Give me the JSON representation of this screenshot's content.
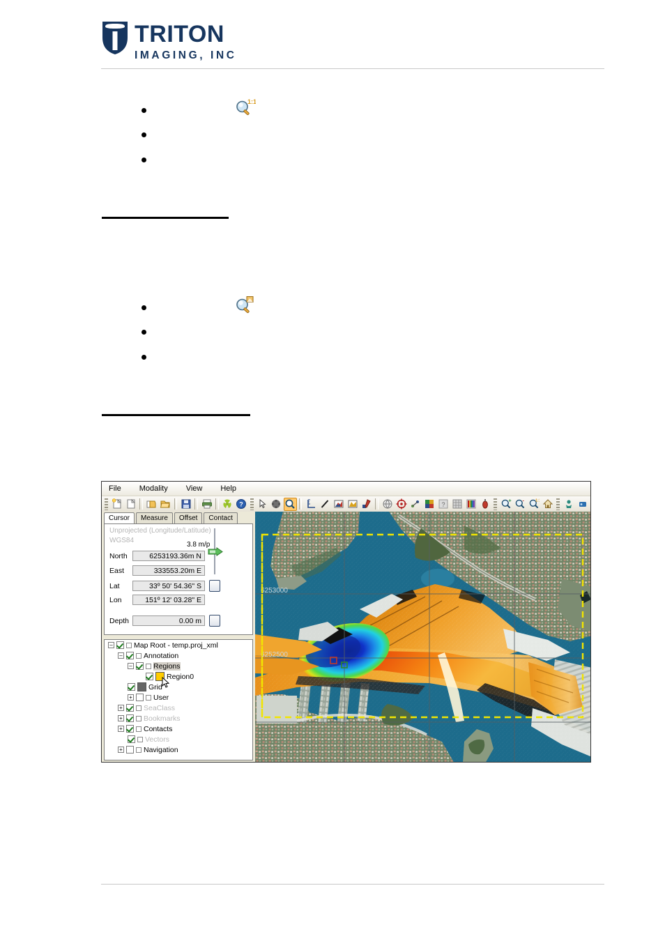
{
  "header": {
    "logo_title": "TRITON",
    "logo_sub": "IMAGING, INC"
  },
  "sections": [
    {
      "icon": "magnifier-one-to-one-icon",
      "bullets": [
        "",
        "",
        ""
      ]
    },
    {
      "icon": "magnifier-region-icon",
      "bullets": [
        "",
        "",
        ""
      ]
    }
  ],
  "app": {
    "menu": [
      "File",
      "Modality",
      "View",
      "Help"
    ],
    "toolbar_groups": [
      {
        "name": "file-group",
        "icons": [
          "new-project-icon",
          "new-document-icon",
          "sep",
          "save-as-icon",
          "open-folder-icon",
          "sep",
          "save-icon",
          "sep",
          "print-icon",
          "sep",
          "radiation-icon",
          "help-icon"
        ]
      },
      {
        "name": "tools-group",
        "icons": [
          "pointer-icon",
          "pan-icon",
          "zoom-select-icon",
          "sep",
          "measure-icon",
          "line-icon",
          "profile-icon",
          "area-icon",
          "paint-icon"
        ]
      },
      {
        "name": "display-group",
        "icons": [
          "globe-icon",
          "target-icon",
          "track-icon",
          "palette-icon",
          "unknown-icon",
          "grid-icon",
          "colorbar-icon",
          "buoy-icon"
        ]
      },
      {
        "name": "zoom-group",
        "icons": [
          "zoom-in-icon",
          "zoom-out-icon",
          "zoom-one-to-one-icon",
          "home-icon"
        ]
      },
      {
        "name": "nav-group",
        "icons": [
          "diver-icon",
          "rov-icon"
        ]
      }
    ],
    "panel": {
      "tabs": [
        {
          "label": "Cursor",
          "active": true
        },
        {
          "label": "Measure",
          "active": false
        },
        {
          "label": "Offset",
          "active": false
        },
        {
          "label": "Contact",
          "active": false
        }
      ],
      "projection": "Unprojected (Longitude/Latitude)",
      "datum": "WGS84",
      "scale": "3.8 m/p",
      "fields": [
        {
          "label": "North",
          "value": "6253193.36m N"
        },
        {
          "label": "East",
          "value": "333553.20m E"
        },
        {
          "label": "Lat",
          "value": "33º 50' 54.36\" S"
        },
        {
          "label": "Lon",
          "value": "151º 12' 03.28\" E"
        },
        {
          "label": "Depth",
          "value": "0.00 m"
        }
      ]
    },
    "tree": [
      {
        "label": "Map Root - temp.proj_xml",
        "depth": 0,
        "expander": "minus",
        "checked": true,
        "marker": "square",
        "grey": false,
        "selected": false
      },
      {
        "label": "Annotation",
        "depth": 1,
        "expander": "minus",
        "checked": true,
        "marker": "square",
        "grey": false,
        "selected": false
      },
      {
        "label": "Regions",
        "depth": 2,
        "expander": "minus",
        "checked": true,
        "marker": "square",
        "grey": false,
        "selected": true
      },
      {
        "label": "Region0",
        "depth": 3,
        "expander": "none",
        "checked": true,
        "marker": "swatch",
        "swatch": "#ffcc00",
        "grey": false,
        "selected": false
      },
      {
        "label": "Grid",
        "depth": 2,
        "expander": "none",
        "checked": true,
        "marker": "swatch",
        "swatch": "#666666",
        "grey": false,
        "selected": false
      },
      {
        "label": "User",
        "depth": 2,
        "expander": "plus",
        "checked": false,
        "marker": "square",
        "grey": false,
        "selected": false
      },
      {
        "label": "SeaClass",
        "depth": 1,
        "expander": "plus",
        "checked": true,
        "marker": "square",
        "grey": true,
        "selected": false
      },
      {
        "label": "Bookmarks",
        "depth": 1,
        "expander": "plus",
        "checked": true,
        "marker": "square",
        "grey": true,
        "selected": false
      },
      {
        "label": "Contacts",
        "depth": 1,
        "expander": "plus",
        "checked": true,
        "marker": "square",
        "grey": false,
        "selected": false
      },
      {
        "label": "Vectors",
        "depth": 1,
        "expander": "none",
        "checked": true,
        "marker": "square",
        "grey": true,
        "selected": false
      },
      {
        "label": "Navigation",
        "depth": 1,
        "expander": "plus",
        "checked": false,
        "marker": "square",
        "grey": false,
        "selected": false
      }
    ],
    "map": {
      "grid_labels": [
        "6253000",
        "6252500"
      ],
      "region_outline_color": "#f2e500",
      "water_color": "#1d6c8c",
      "grid_line_color": "#555f63"
    }
  }
}
